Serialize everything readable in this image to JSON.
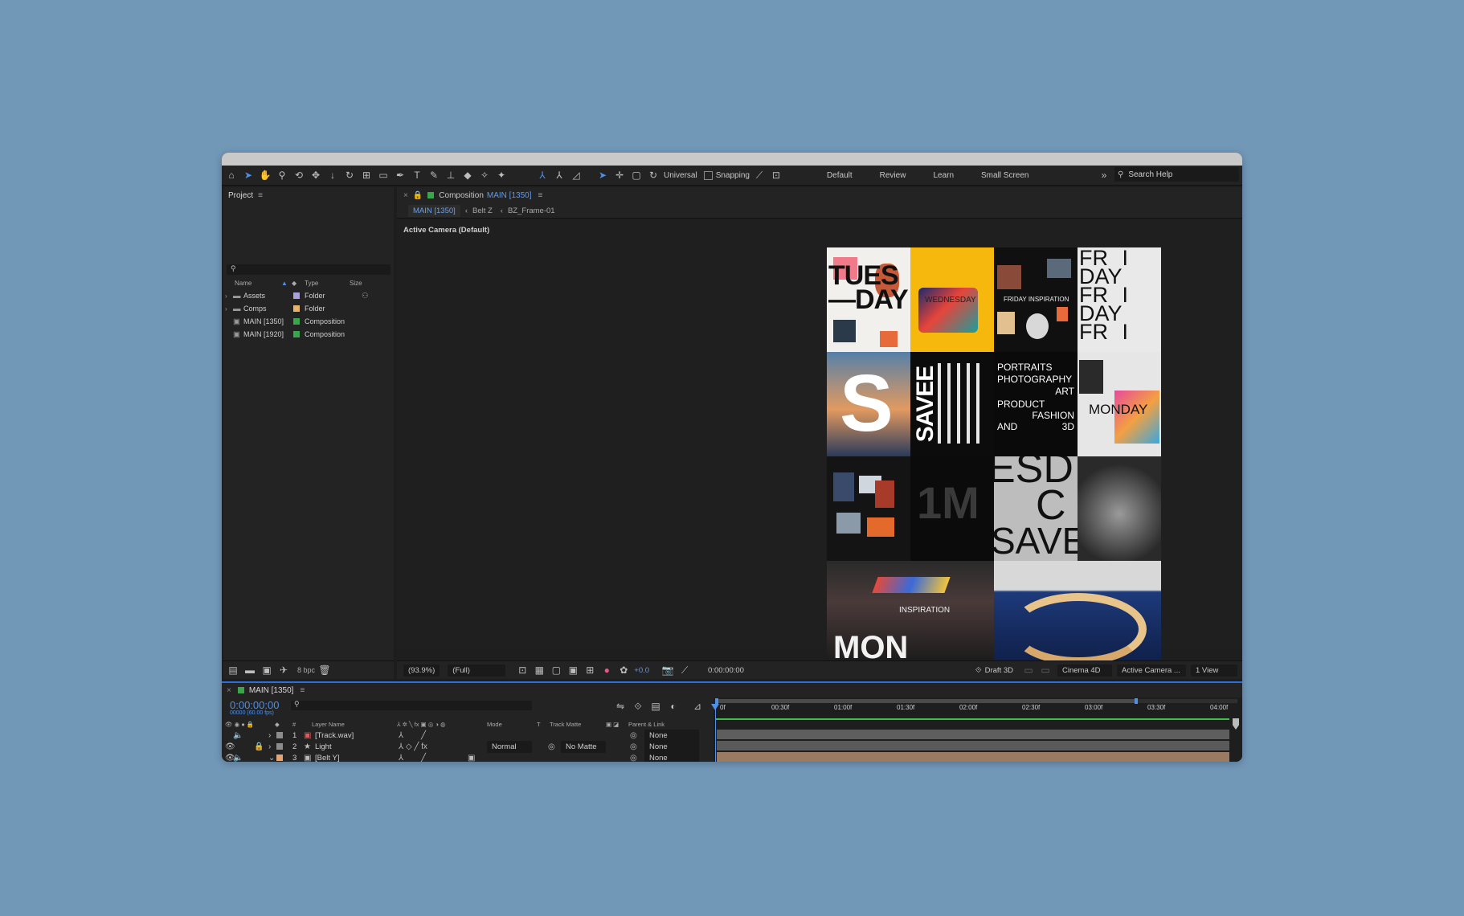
{
  "toolbar": {
    "universal_label": "Universal",
    "snapping_label": "Snapping",
    "workspaces": [
      "Default",
      "Review",
      "Learn",
      "Small Screen"
    ],
    "search_placeholder": "Search Help"
  },
  "project": {
    "title": "Project",
    "columns": {
      "name": "Name",
      "type": "Type",
      "size": "Size"
    },
    "items": [
      {
        "name": "Assets",
        "type": "Folder",
        "color": "#a7a3d8"
      },
      {
        "name": "Comps",
        "type": "Folder",
        "color": "#e8b46b"
      },
      {
        "name": "MAIN [1350]",
        "type": "Composition",
        "color": "#3aa64b"
      },
      {
        "name": "MAIN [1920]",
        "type": "Composition",
        "color": "#3aa64b"
      }
    ],
    "bpc": "8 bpc"
  },
  "composition": {
    "tab_prefix": "Composition",
    "tab_name": "MAIN [1350]",
    "crumbs": [
      "MAIN [1350]",
      "Belt Z",
      "BZ_Frame-01"
    ],
    "camera_label": "Active Camera (Default)",
    "zoom": "(93.9%)",
    "resolution": "(Full)",
    "exposure": "+0.0",
    "timecode": "0:00:00:00",
    "renderer_label": "Draft 3D",
    "renderer": "Cinema 4D",
    "camera": "Active Camera ...",
    "views": "1 View"
  },
  "artwork": {
    "tuesday": "TUES—DAY",
    "wednesday": "WEDNESDAY",
    "friday_inspiration": "FRIDAY INSPIRATION",
    "friday": "FR I DAY FR I DAY FR I",
    "s_letter": "S",
    "savee": "SAVEE",
    "portraits": [
      "PORTRAITS",
      "PHOTOGRAPHY",
      "ART",
      "PRODUCT",
      "FASHION",
      "AND",
      "3D"
    ],
    "monday": "MONDAY",
    "one_m": "1M",
    "esd": "ESD",
    "c": "C",
    "save": "SAVE",
    "inspiration": "INSPIRATION",
    "mon": "MON"
  },
  "timeline": {
    "tab_name": "MAIN [1350]",
    "timecode": "0:00:00:00",
    "fps": "00000 (60.00 fps)",
    "headers": {
      "num": "#",
      "layer": "Layer Name",
      "mode": "Mode",
      "t": "T",
      "track_matte": "Track Matte",
      "parent": "Parent & Link"
    },
    "layers": [
      {
        "num": "1",
        "name": "[Track.wav]",
        "mode": "",
        "matte": "",
        "parent": "None",
        "color": "#8c8c8c"
      },
      {
        "num": "2",
        "name": "Light",
        "mode": "Normal",
        "matte": "No Matte",
        "parent": "None",
        "color": "#8c8c8c"
      },
      {
        "num": "3",
        "name": "[Belt Y]",
        "mode": "",
        "matte": "",
        "parent": "None",
        "color": "#e4a474"
      }
    ],
    "ticks": [
      "0f",
      "00:30f",
      "01:00f",
      "01:30f",
      "02:00f",
      "02:30f",
      "03:00f",
      "03:30f",
      "04:00f"
    ]
  }
}
